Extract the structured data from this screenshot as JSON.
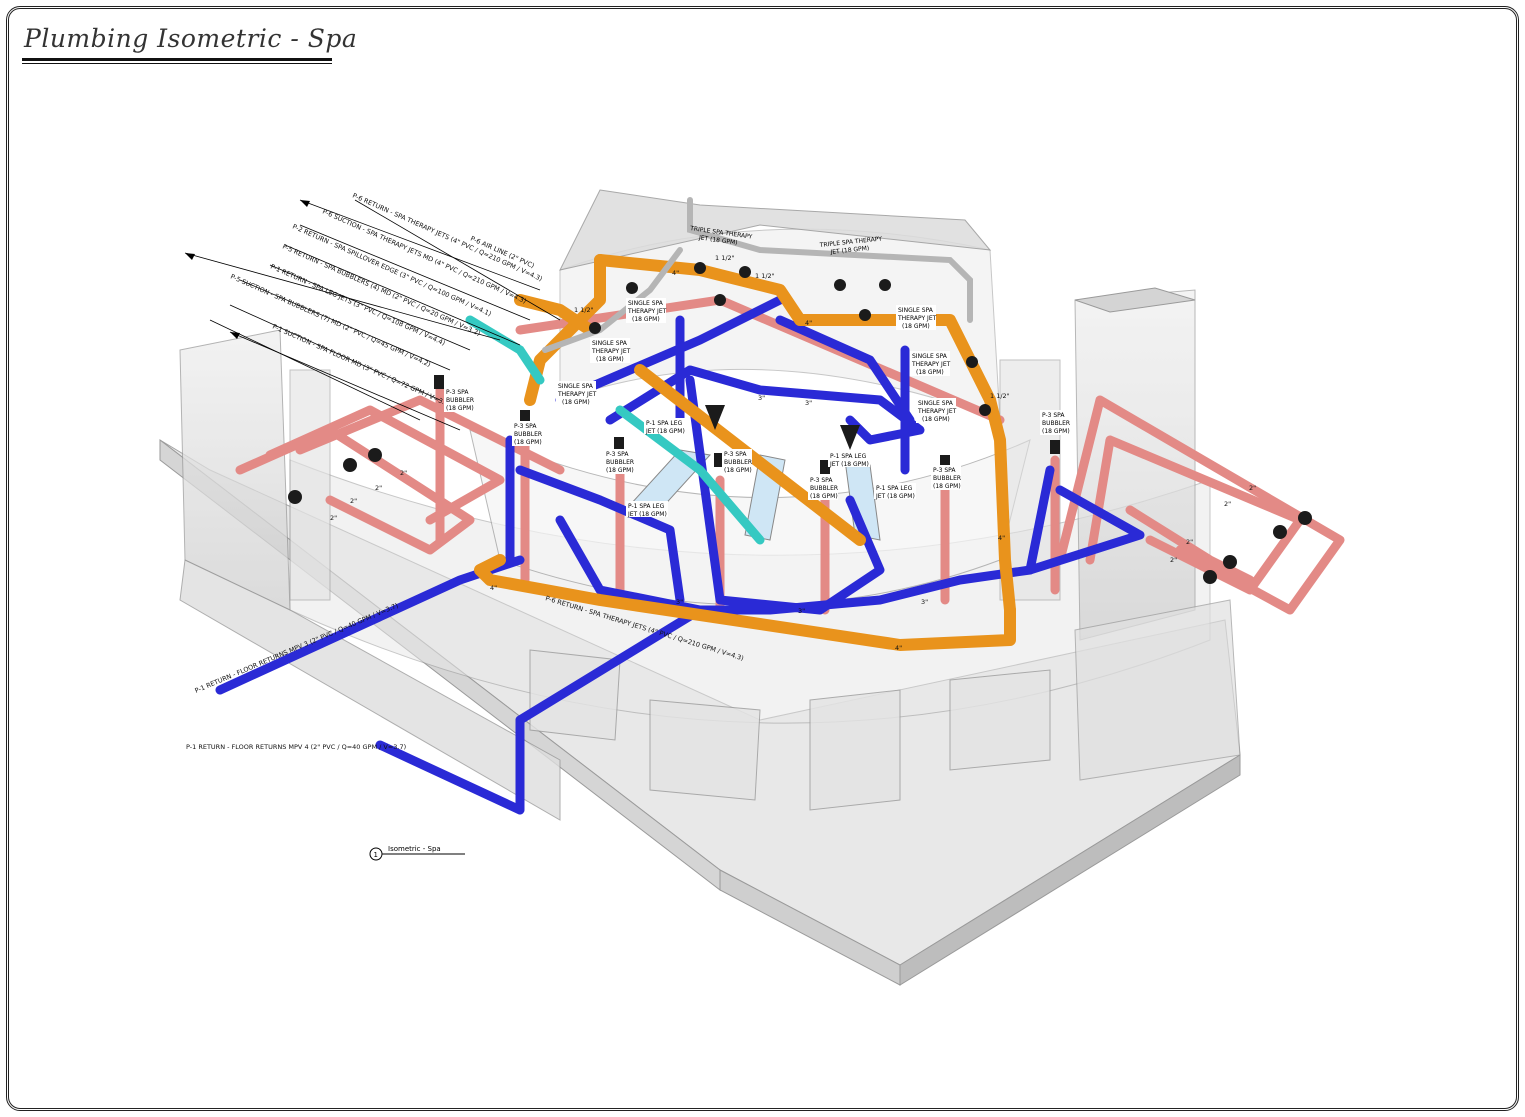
{
  "sheet": {
    "title": "Plumbing Isometric - Spa"
  },
  "view_tag": {
    "number": "1",
    "name": "Isometric - Spa"
  },
  "pipe_callouts": [
    "P-6 RETURN - SPA THERAPY JETS (4\" PVC / Q=210 GPM / V=4.3)",
    "P-6 SUCTION - SPA THERAPY JETS MD (4\" PVC / Q=210 GPM / V=4.3)",
    "P-2 RETURN - SPA SPILLOVER EDGE (3\" PVC / Q=100 GPM / V=4.1)",
    "P-5 RETURN - SPA BUBBLERS (4) MD (2\" PVC / Q=20 GPM / V=3.2)",
    "P-5 SUCTION - SPA BUBBLERS (7) MD (2\" PVC / Q=45 GPM / V=4.2)",
    "P-1 RETURN - SPA LEG JETS (3\" PVC / Q=108 GPM / V=4.4)",
    "P-1 SUCTION - SPA FLOOR MD (3\" PVC / Q=72 GPM / V=3.1)",
    "P-6 AIR LINE (2\" PVC)",
    "P-6 RETURN - SPA THERAPY JETS (4\" PVC / Q=210 GPM / V=4.3)",
    "P-1 RETURN - FLOOR RETURNS MPV 3 (2\" PVC / Q=40 GPM / V=3.7)",
    "P-1 RETURN - FLOOR RETURNS MPV 4 (2\" PVC / Q=40 GPM / V=3.7)"
  ],
  "fixture_tags": {
    "triple_jet_1": [
      "TRIPLE SPA THERAPY",
      "JET (18 GPM)"
    ],
    "triple_jet_2": [
      "TRIPLE SPA THERAPY",
      "JET (18 GPM)"
    ],
    "single_jet": [
      "SINGLE SPA",
      "THERAPY JET",
      "(18 GPM)"
    ],
    "bubbler": [
      "P-3 SPA",
      "BUBBLER",
      "(18 GPM)"
    ],
    "leg_jet": [
      "P-1 SPA LEG",
      "JET (18 GPM)"
    ]
  },
  "pipe_sizes": {
    "s4": "4\"",
    "s3": "3\"",
    "s2": "2\"",
    "s1half": "1 1/2\""
  },
  "colors": {
    "orange_pipe": "#e9931c",
    "blue_pipe": "#2a2ad6",
    "pink_pipe": "#e38a86",
    "cyan_pipe": "#35c9c2",
    "structure": "#d9d9d9",
    "structure_edge": "#9a9a9a"
  }
}
